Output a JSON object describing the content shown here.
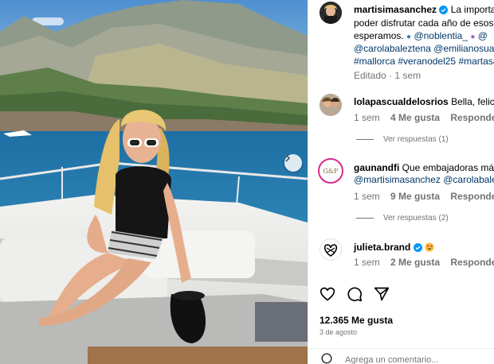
{
  "post": {
    "author": "martisimasanchez",
    "caption_lines": [
      "La importancia",
      "poder disfrutar cada año de esos d",
      "esperamos."
    ],
    "caption_tags_line1": [
      "@noblentia_",
      "@"
    ],
    "caption_tags_line2": [
      "@carolabaleztena",
      "@emilianosuarez"
    ],
    "caption_tags_line3": [
      "#mallorca",
      "#veranodel25",
      "#martasan"
    ],
    "edited_label": "Editado",
    "edited_time": "1 sem"
  },
  "comments": [
    {
      "user": "lolapascualdelosrios",
      "text": "Bella, felices",
      "time": "1 sem",
      "likes": "4 Me gusta",
      "reply_label": "Responder",
      "view_replies": "Ver respuestas (1)"
    },
    {
      "user": "gaunandfi",
      "text": "Que embajadoras más",
      "mentions": "@martisimasanchez @carolabalezt",
      "time": "1 sem",
      "likes": "9 Me gusta",
      "reply_label": "Responder",
      "view_replies": "Ver respuestas (2)",
      "avatar_text": "G&F"
    },
    {
      "user": "julieta.brand",
      "time": "1 sem",
      "likes": "2 Me gusta",
      "reply_label": "Responder"
    }
  ],
  "likes_count": "12.365 Me gusta",
  "post_date": "3 de agosto",
  "comment_placeholder": "Agrega un comentario...",
  "colors": {
    "verified": "#0095f6",
    "link": "#00376b",
    "meta": "#737373",
    "like_red": "#ed4956"
  },
  "icons": [
    "verified-icon",
    "heart-icon",
    "comment-icon",
    "share-icon",
    "chevron-right-icon",
    "more-icon",
    "smiley-icon",
    "emoji-heart-eyes"
  ]
}
